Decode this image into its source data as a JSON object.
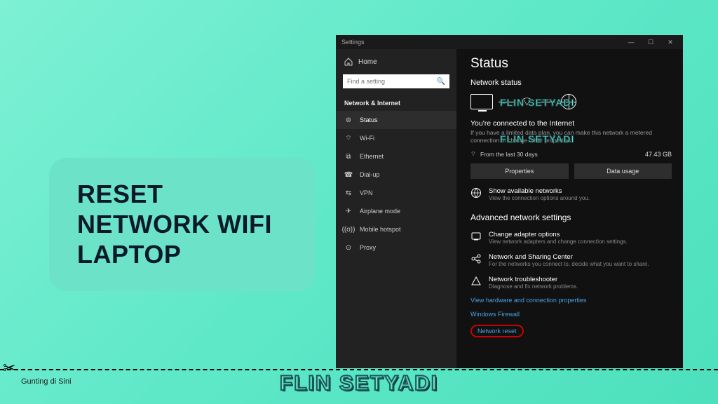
{
  "callout": {
    "text": "RESET NETWORK WIFI LAPTOP"
  },
  "cut": {
    "label": "Gunting di Sini"
  },
  "watermark": "FLIN SETYADI",
  "window": {
    "title": "Settings",
    "controls": {
      "min": "—",
      "max": "☐",
      "close": "✕"
    }
  },
  "sidebar": {
    "home": "Home",
    "search_placeholder": "Find a setting",
    "section": "Network & Internet",
    "items": [
      {
        "label": "Status",
        "icon": "⊜",
        "active": true
      },
      {
        "label": "Wi-Fi",
        "icon": "⌔"
      },
      {
        "label": "Ethernet",
        "icon": "⧉"
      },
      {
        "label": "Dial-up",
        "icon": "☎"
      },
      {
        "label": "VPN",
        "icon": "⇆"
      },
      {
        "label": "Airplane mode",
        "icon": "✈"
      },
      {
        "label": "Mobile hotspot",
        "icon": "((o))"
      },
      {
        "label": "Proxy",
        "icon": "⊙"
      }
    ]
  },
  "content": {
    "page_title": "Status",
    "sub1": "Network status",
    "connected_title": "You're connected to the Internet",
    "connected_sub": "If you have a limited data plan, you can make this network a metered connection or change other properties.",
    "usage_label": "From the last 30 days",
    "usage_value": "47.43 GB",
    "btn_properties": "Properties",
    "btn_datausage": "Data usage",
    "show_net_title": "Show available networks",
    "show_net_sub": "View the connection options around you.",
    "adv_head": "Advanced network settings",
    "adapter_title": "Change adapter options",
    "adapter_sub": "View network adapters and change connection settings.",
    "sharing_title": "Network and Sharing Center",
    "sharing_sub": "For the networks you connect to, decide what you want to share.",
    "troubleshoot_title": "Network troubleshooter",
    "troubleshoot_sub": "Diagnose and fix network problems.",
    "link_hw": "View hardware and connection properties",
    "link_fw": "Windows Firewall",
    "link_reset": "Network reset"
  }
}
